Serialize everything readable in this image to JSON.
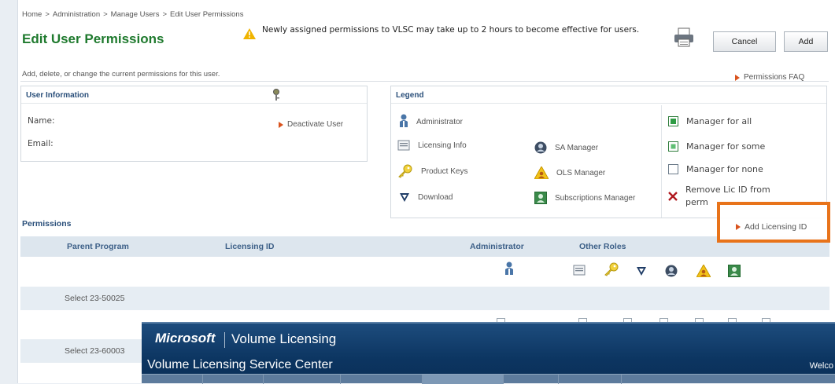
{
  "breadcrumb": [
    "Home",
    "Administration",
    "Manage Users",
    "Edit User Permissions"
  ],
  "breadcrumb_sep": ">",
  "page_title": "Edit User Permissions",
  "notice_text": "Newly assigned permissions to VLSC may take up to 2 hours to become effective for users.",
  "buttons": {
    "cancel": "Cancel",
    "add": "Add"
  },
  "subtitle": "Add, delete, or change the current permissions for this user.",
  "faq_link": "Permissions FAQ",
  "user_info": {
    "header": "User Information",
    "name_label": "Name:",
    "email_label": "Email:",
    "deactivate_link": "Deactivate User"
  },
  "legend": {
    "header": "Legend",
    "administrator": "Administrator",
    "licensing_info": "Licensing Info",
    "sa_manager": "SA Manager",
    "product_keys": "Product Keys",
    "ols_manager": "OLS Manager",
    "download": "Download",
    "subscriptions_manager": "Subscriptions Manager",
    "manager_all": "Manager for all",
    "manager_some": "Manager for some",
    "manager_none": "Manager for none",
    "remove_lic_1": "Remove Lic ID from",
    "remove_lic_2": "perm"
  },
  "permissions": {
    "title": "Permissions",
    "add_licensing_id": "Add Licensing ID",
    "columns": {
      "parent_program": "Parent Program",
      "licensing_id": "Licensing ID",
      "administrator": "Administrator",
      "other_roles": "Other Roles"
    },
    "rows": [
      {
        "label": "Select  23-50025"
      },
      {
        "label": "Select  23-60003"
      }
    ]
  },
  "overlay": {
    "brand": "Microsoft",
    "product": "Volume Licensing",
    "service": "Volume Licensing Service Center",
    "welcome": "Welco"
  },
  "colors": {
    "title_green": "#1f7a2e",
    "header_blue": "#2a4f7a",
    "highlight_orange": "#e8731a",
    "arrow_orange": "#d9531e",
    "overlay_navy": "#0c3561"
  }
}
